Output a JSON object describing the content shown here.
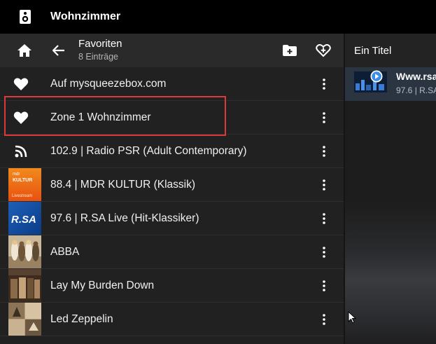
{
  "header": {
    "title": "Wohnzimmer",
    "icon": "speaker-icon"
  },
  "toolbar": {
    "title": "Favoriten",
    "subtitle": "8 Einträge"
  },
  "list": [
    {
      "label": "Auf mysqueezebox.com",
      "icon": "heart-icon"
    },
    {
      "label": "Zone 1 Wohnzimmer",
      "icon": "heart-icon"
    },
    {
      "label": "102.9 | Radio PSR (Adult Contemporary)",
      "icon": "rss-icon"
    },
    {
      "label": "88.4 | MDR KULTUR (Klassik)",
      "icon": "mdr-kultur-thumbnail",
      "thumb_text": [
        "mdr",
        "KULTUR",
        "Livestream"
      ]
    },
    {
      "label": "97.6 | R.SA Live (Hit-Klassiker)",
      "icon": "rsa-thumbnail",
      "thumb_text": [
        "R.SA"
      ]
    },
    {
      "label": "ABBA",
      "icon": "abba-thumbnail"
    },
    {
      "label": "Lay My Burden Down",
      "icon": "album-cover-thumbnail"
    },
    {
      "label": "Led Zeppelin",
      "icon": "led-zeppelin-thumbnail"
    }
  ],
  "queue": {
    "header": "Ein Titel",
    "items": [
      {
        "title": "Www.rsa",
        "subtitle": "97.6 | R.SA"
      }
    ]
  },
  "colors": {
    "accent": "#d93b3b",
    "now_playing_bg": "#2b3542",
    "play_blue": "#3a8ee6"
  }
}
